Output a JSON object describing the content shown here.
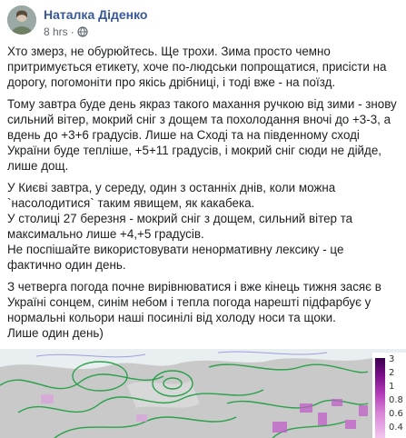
{
  "post": {
    "author": "Наталка Діденко",
    "time": "8 hrs",
    "separator": "·",
    "paragraphs": [
      "Хто змерз, не обурюйтесь. Ще трохи. Зима просто чемно притримується етикету, хоче по-людськи попрощатися, присісти на дорогу, погомоніти про якісь дрібниці, і тоді вже - на поїзд.",
      "Тому завтра буде день якраз такого махання ручкою від зими - знову сильний вітер, мокрий сніг з дощем та похолодання вночі до +3-3, а вдень до +3+6 градусів. Лише на Сході та на південному сході України буде тепліше, +5+11 градусів, і мокрий сніг сюди не дійде, лише дощ.",
      "У Києві завтра, у середу, один з останніх днів, коли можна `насолодитися` таким явищем, як какабека.",
      "У столиці 27 березня - мокрий сніг з дощем, сильний вітер та максимально лише +4,+5 градусів.",
      "Не поспішайте використовувати ненормативну лексику - це фактично один день.",
      "З четверга погода почне вирівнюватися і вже кінець тижня засяє в Україні сонцем, синім небом і тепла погода нарешті підфарбує у нормальні кольори наші посинілі від холоду носи та щоки.",
      "Лише один день)"
    ],
    "icons": {
      "avatar": "user-avatar",
      "privacy": "globe-icon"
    }
  },
  "map": {
    "legend_labels": [
      "3",
      "2",
      "1",
      "0.8",
      "0.6",
      "0.4"
    ],
    "colors": {
      "land": "#c9c9c9",
      "sea": "#e9eef0",
      "isobar": "#2aa14a",
      "precip": "#c060c8"
    }
  }
}
